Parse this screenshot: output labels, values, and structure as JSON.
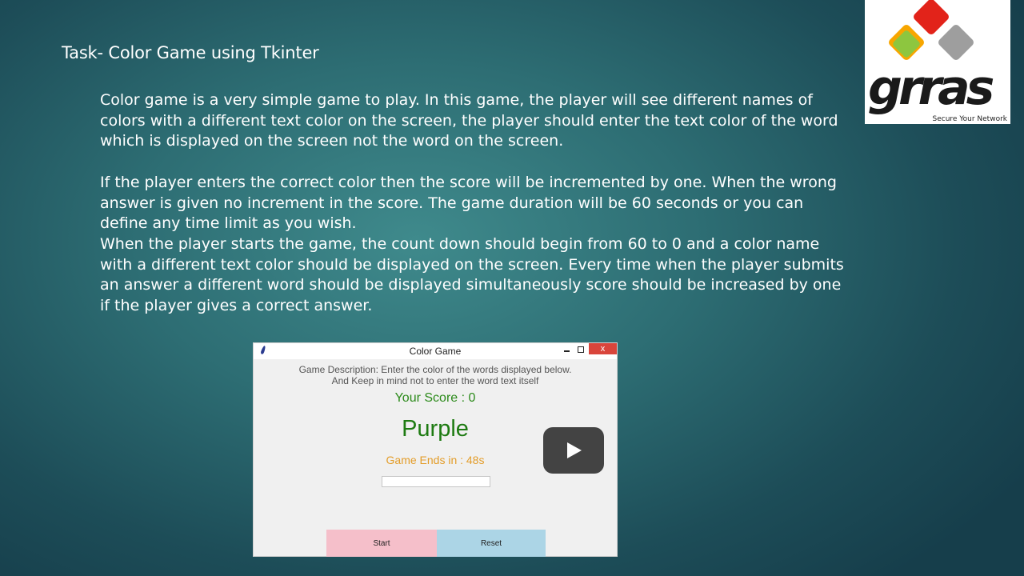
{
  "slide": {
    "title": "Task- Color Game using Tkinter",
    "paragraph1": "Color game is a very simple game to play. In this game, the player will see different names of colors with a different text color on the screen, the player should enter the text color of the word which is displayed on the screen not the word on the screen.",
    "paragraph2": "If the player enters the correct color then the score will be incremented by one. When the wrong answer is given no increment in the score. The game duration will be 60 seconds or you can define any time limit as you wish.",
    "paragraph3": "When the player starts the game, the count down should begin from 60 to 0 and a color name with a different text color should be displayed on the screen. Every time when the player submits an answer a different word should be displayed simultaneously score should be increased by one if the player gives a correct answer."
  },
  "logo": {
    "wordmark": "grras",
    "tagline": "Secure Your Network",
    "colors": [
      "#e2231a",
      "#f7a600",
      "#8dc63f",
      "#9e9e9e"
    ]
  },
  "window": {
    "title": "Color Game",
    "close_label": "x",
    "description_line1": "Game Description: Enter the color of the words displayed below.",
    "description_line2": "And Keep in mind not to enter the word text itself",
    "score_text": "Your Score : 0",
    "word_text": "Purple",
    "timer_text": "Game Ends in : 48s",
    "input_value": "",
    "start_label": "Start",
    "reset_label": "Reset",
    "play_icon": "play-icon",
    "colors": {
      "score": "#2b8a1a",
      "word": "#1e7b12",
      "timer": "#e39d2a",
      "start_bg": "#f5bfca",
      "reset_bg": "#acd5e6"
    }
  }
}
